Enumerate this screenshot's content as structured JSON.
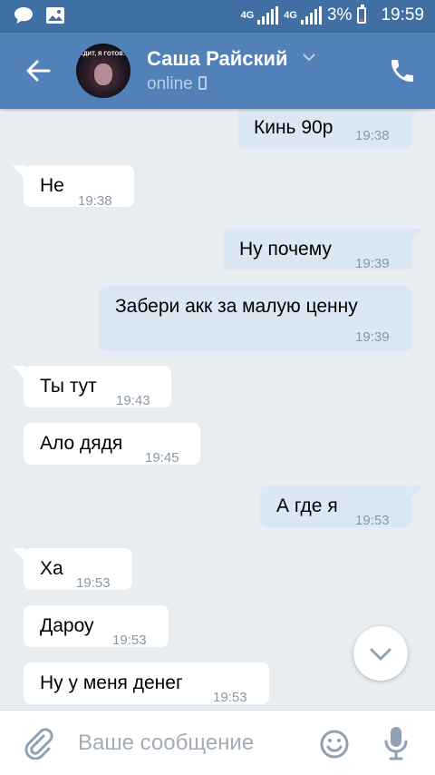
{
  "status_bar": {
    "network_1": "4G",
    "network_2": "4G",
    "battery": "3%",
    "time": "19:59"
  },
  "header": {
    "contact_name": "Саша Райский",
    "status": "online",
    "avatar_caption": "ЖДИТ, Я ГОТОВ..."
  },
  "messages": [
    {
      "text": "Кинь 90р",
      "time": "19:38",
      "direction": "out"
    },
    {
      "text": "Не",
      "time": "19:38",
      "direction": "in"
    },
    {
      "text": "Ну почему",
      "time": "19:39",
      "direction": "out"
    },
    {
      "text": "Забери акк за малую ценну",
      "time": "19:39",
      "direction": "out"
    },
    {
      "text": "Ты тут",
      "time": "19:43",
      "direction": "in"
    },
    {
      "text": "Ало дядя",
      "time": "19:45",
      "direction": "in"
    },
    {
      "text": "А где я",
      "time": "19:53",
      "direction": "out"
    },
    {
      "text": "Ха",
      "time": "19:53",
      "direction": "in"
    },
    {
      "text": "Дароу",
      "time": "19:53",
      "direction": "in"
    },
    {
      "text": "Ну у меня денег",
      "time": "19:53",
      "direction": "in"
    }
  ],
  "composer": {
    "placeholder": "Ваше сообщение"
  },
  "icons": {
    "back": "arrow-left-icon",
    "dropdown": "chevron-down-icon",
    "call": "phone-icon",
    "scroll": "chevron-down-icon",
    "attach": "paperclip-icon",
    "emoji": "smiley-icon",
    "mic": "microphone-icon"
  },
  "colors": {
    "status_bar": "#3f6fa3",
    "header": "#5181b8",
    "chat_bg": "#e8edf2",
    "outgoing_bubble": "#dce7f4",
    "incoming_bubble": "#ffffff"
  }
}
